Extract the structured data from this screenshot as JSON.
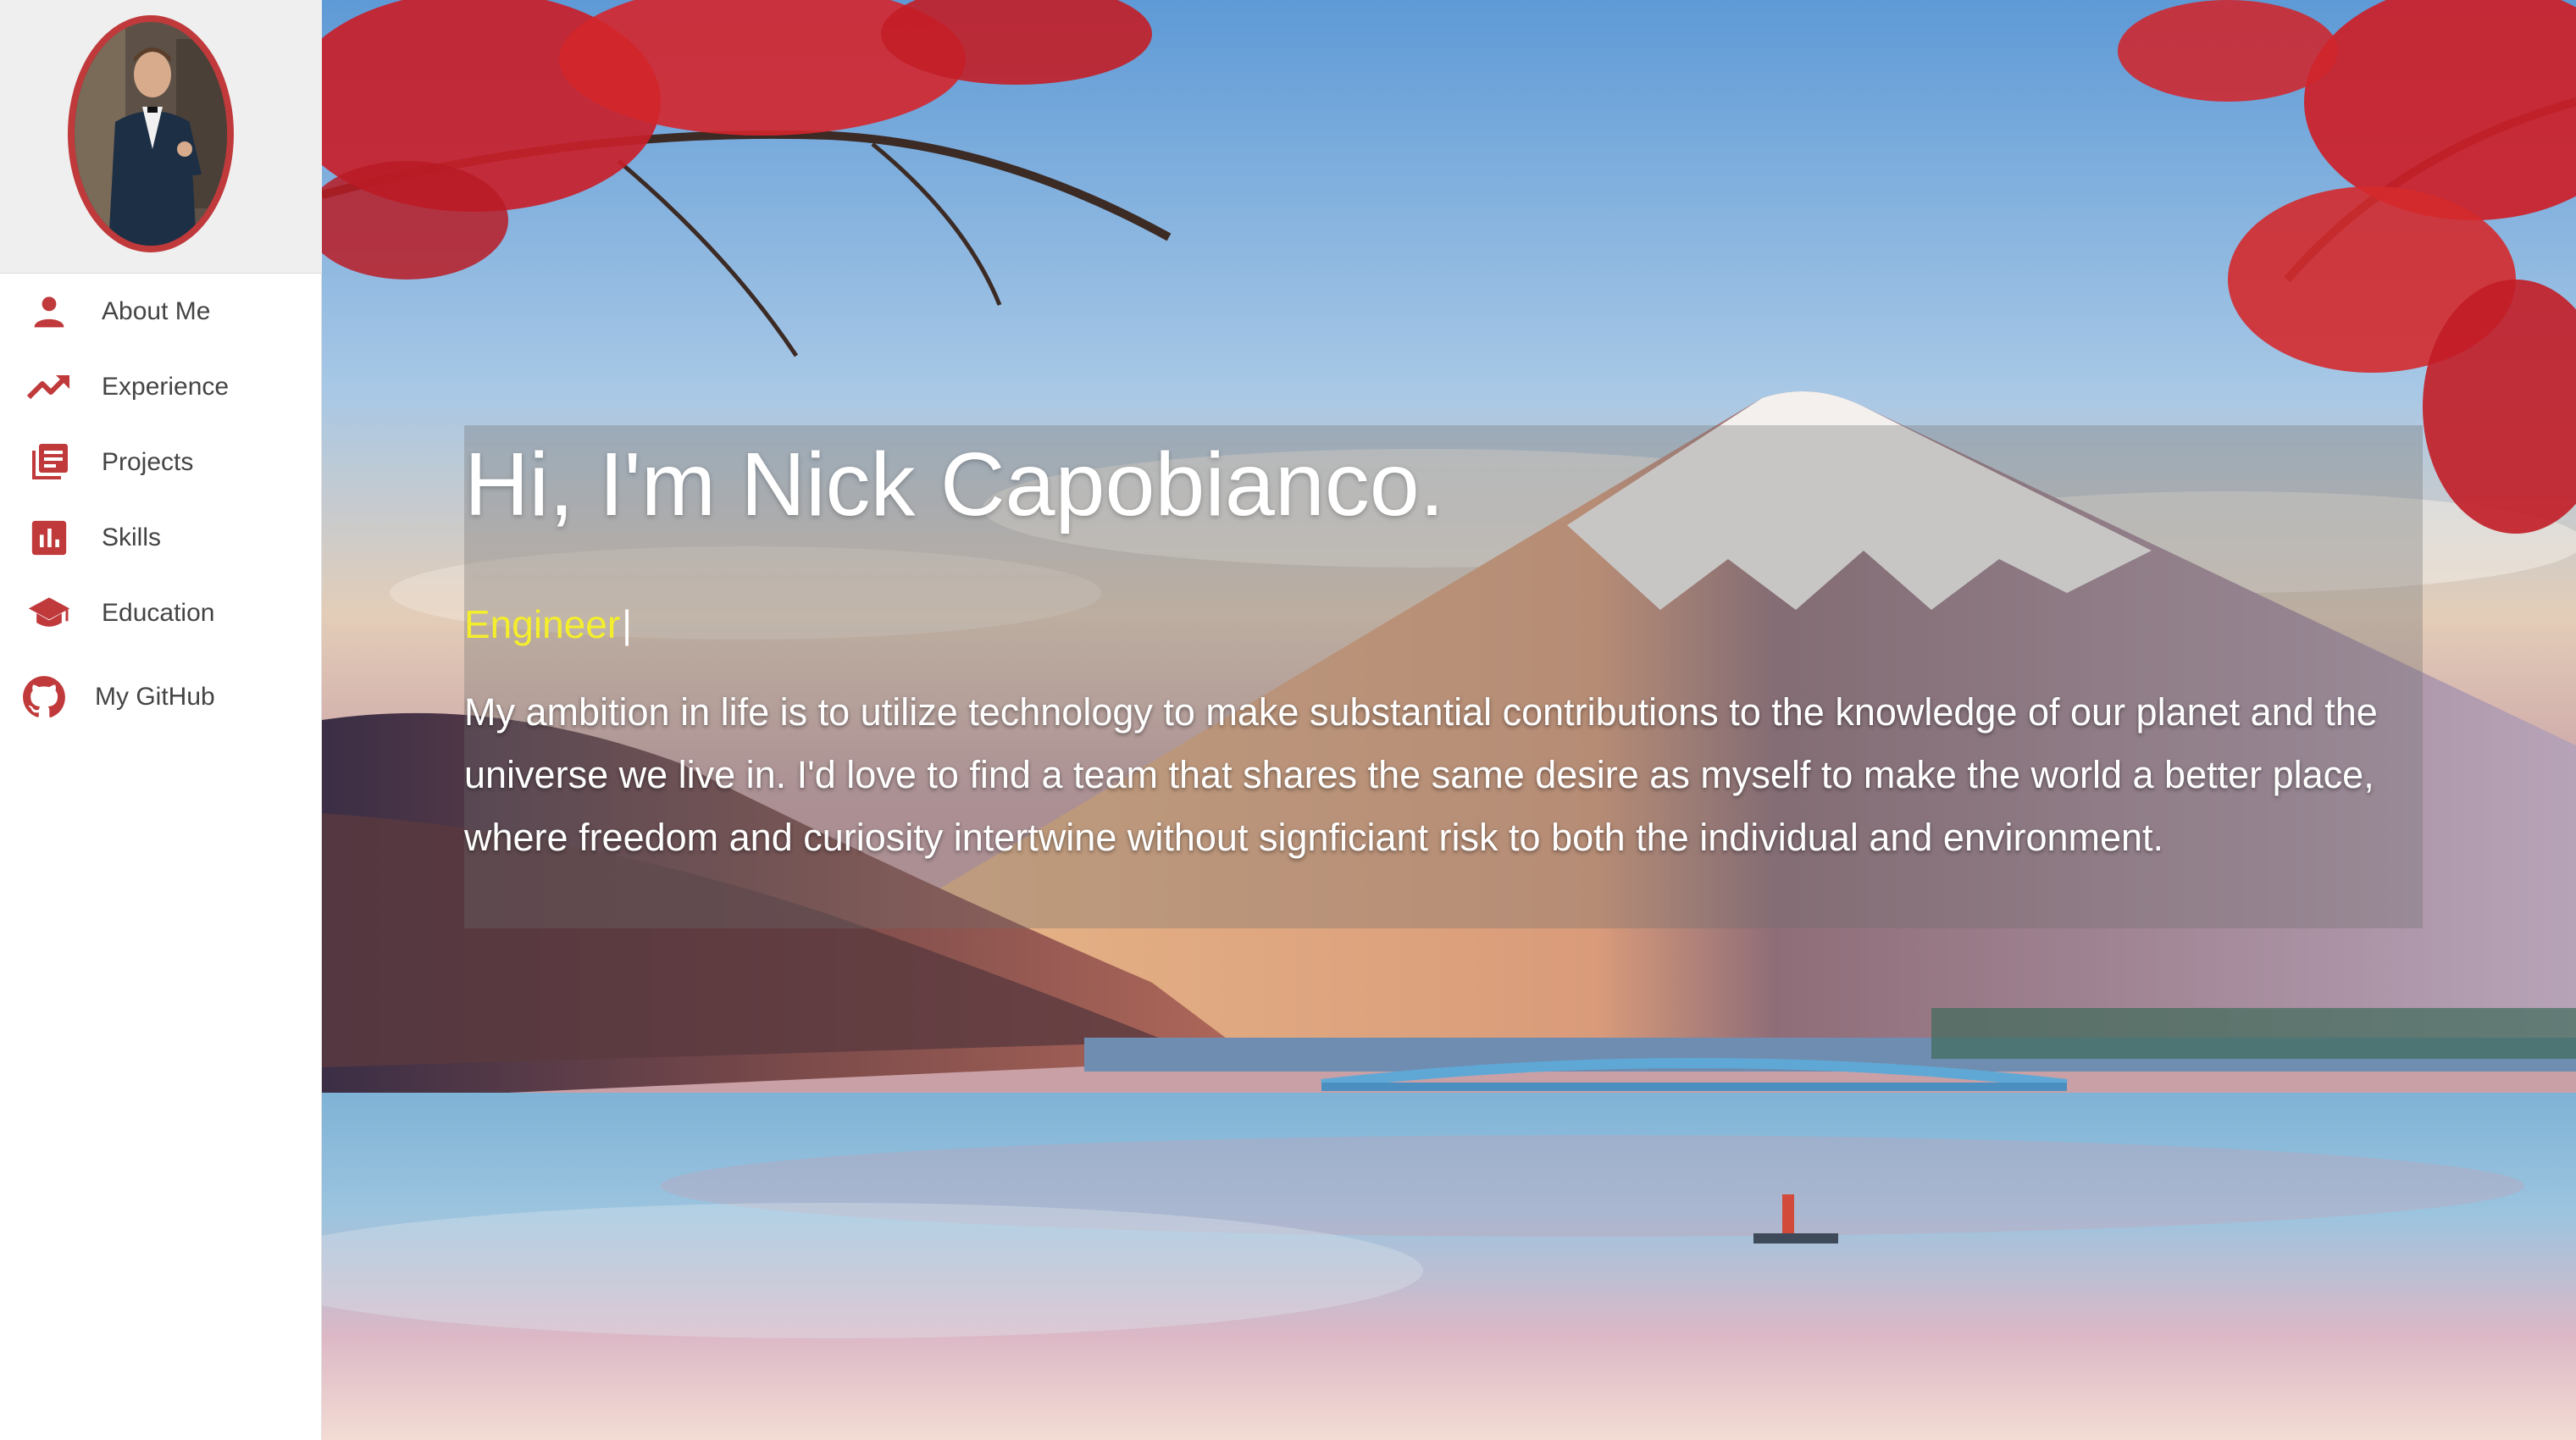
{
  "sidebar": {
    "avatar": {
      "icon": "profile-photo"
    },
    "items": [
      {
        "label": "About Me",
        "icon": "person-icon"
      },
      {
        "label": "Experience",
        "icon": "trending-up-icon"
      },
      {
        "label": "Projects",
        "icon": "library-books-icon"
      },
      {
        "label": "Skills",
        "icon": "bar-chart-icon"
      },
      {
        "label": "Education",
        "icon": "graduation-cap-icon"
      },
      {
        "label": "My GitHub",
        "icon": "github-icon"
      }
    ]
  },
  "hero": {
    "background": "mount-fuji-autumn-lake-scene",
    "headline": "Hi, I'm Nick Capobianco.",
    "role": "Engineer",
    "cursor": "|",
    "ambition": "My ambition in life is to utilize technology to make substantial contributions to the knowledge of our planet and the universe we live in. I'd love to find a team that shares the same desire as myself to make the world a better place, where freedom and curiosity intertwine without signficiant risk to both the individual and environment."
  },
  "colors": {
    "accent": "#c0393b",
    "role_text": "#f4ee2c",
    "nav_text": "#444444"
  }
}
